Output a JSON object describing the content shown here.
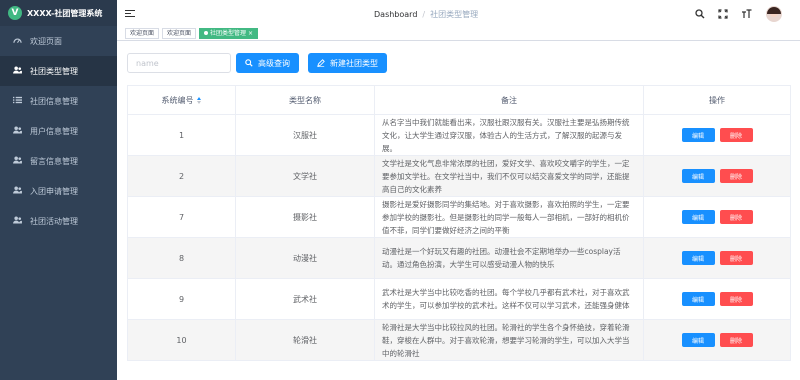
{
  "app": {
    "logo_letter": "V",
    "title": "XXXX-社团管理系统"
  },
  "sidebar": {
    "items": [
      {
        "label": "欢迎页面",
        "icon": "dashboard-icon",
        "active": false
      },
      {
        "label": "社团类型管理",
        "icon": "users-icon",
        "active": true
      },
      {
        "label": "社团信息管理",
        "icon": "list-icon",
        "active": false
      },
      {
        "label": "用户信息管理",
        "icon": "users-icon",
        "active": false
      },
      {
        "label": "留言信息管理",
        "icon": "users-icon",
        "active": false
      },
      {
        "label": "入团申请管理",
        "icon": "users-icon",
        "active": false
      },
      {
        "label": "社团活动管理",
        "icon": "users-icon",
        "active": false
      }
    ]
  },
  "header": {
    "breadcrumb_home": "Dashboard",
    "breadcrumb_sep": "/",
    "breadcrumb_current": "社团类型管理"
  },
  "tags": {
    "items": [
      "欢迎页面",
      "欢迎页面",
      "社团类型管理"
    ],
    "close": "×"
  },
  "toolbar": {
    "search_placeholder": "name",
    "search_label": "高级查询",
    "new_label": "新建社团类型"
  },
  "table": {
    "columns": [
      "系统编号",
      "类型名称",
      "备注",
      "操作"
    ],
    "edit_label": "编辑",
    "delete_label": "删除",
    "rows": [
      {
        "id": "1",
        "name": "汉服社",
        "desc": "从名字当中我们就能看出来，汉服社跟汉服有关。汉服社主要是弘扬期传统文化，让大学生通过穿汉服，体验古人的生活方式，了解汉服的起源与发展。"
      },
      {
        "id": "2",
        "name": "文学社",
        "desc": "文学社是文化气息非常浓厚的社团，爱好文学、喜欢咬文嚼字的学生，一定要参加文学社。在文学社当中，我们不仅可以结交喜爱文学的同学，还能提高自己的文化素养"
      },
      {
        "id": "7",
        "name": "摄影社",
        "desc": "摄影社是爱好摄影同学的集结地。对于喜欢摄影，喜欢拍照的学生，一定要参加学校的摄影社。但是摄影社的同学一般每人一部相机，一部好的相机价值不菲，同学们要做好经济之间的平衡"
      },
      {
        "id": "8",
        "name": "动漫社",
        "desc": "动漫社是一个好玩又有趣的社团。动漫社会不定期地举办一些cosplay活动。通过角色扮演，大学生可以感受动漫人物的快乐"
      },
      {
        "id": "9",
        "name": "武术社",
        "desc": "武术社是大学当中比较吃香的社团。每个学校几乎都有武术社，对于喜欢武术的学生，可以参加学校的武术社。这样不仅可以学习武术，还能强身健体"
      },
      {
        "id": "10",
        "name": "轮滑社",
        "desc": "轮滑社是大学当中比较拉风的社团。轮滑社的学生各个身怀绝技，穿着轮滑鞋，穿梭在人群中。对于喜欢轮滑，想要学习轮滑的学生，可以加入大学当中的轮滑社"
      }
    ]
  },
  "colors": {
    "sidebar_bg": "#304156",
    "primary": "#1890ff",
    "danger": "#ff4d4f",
    "tag_active": "#42b983"
  }
}
